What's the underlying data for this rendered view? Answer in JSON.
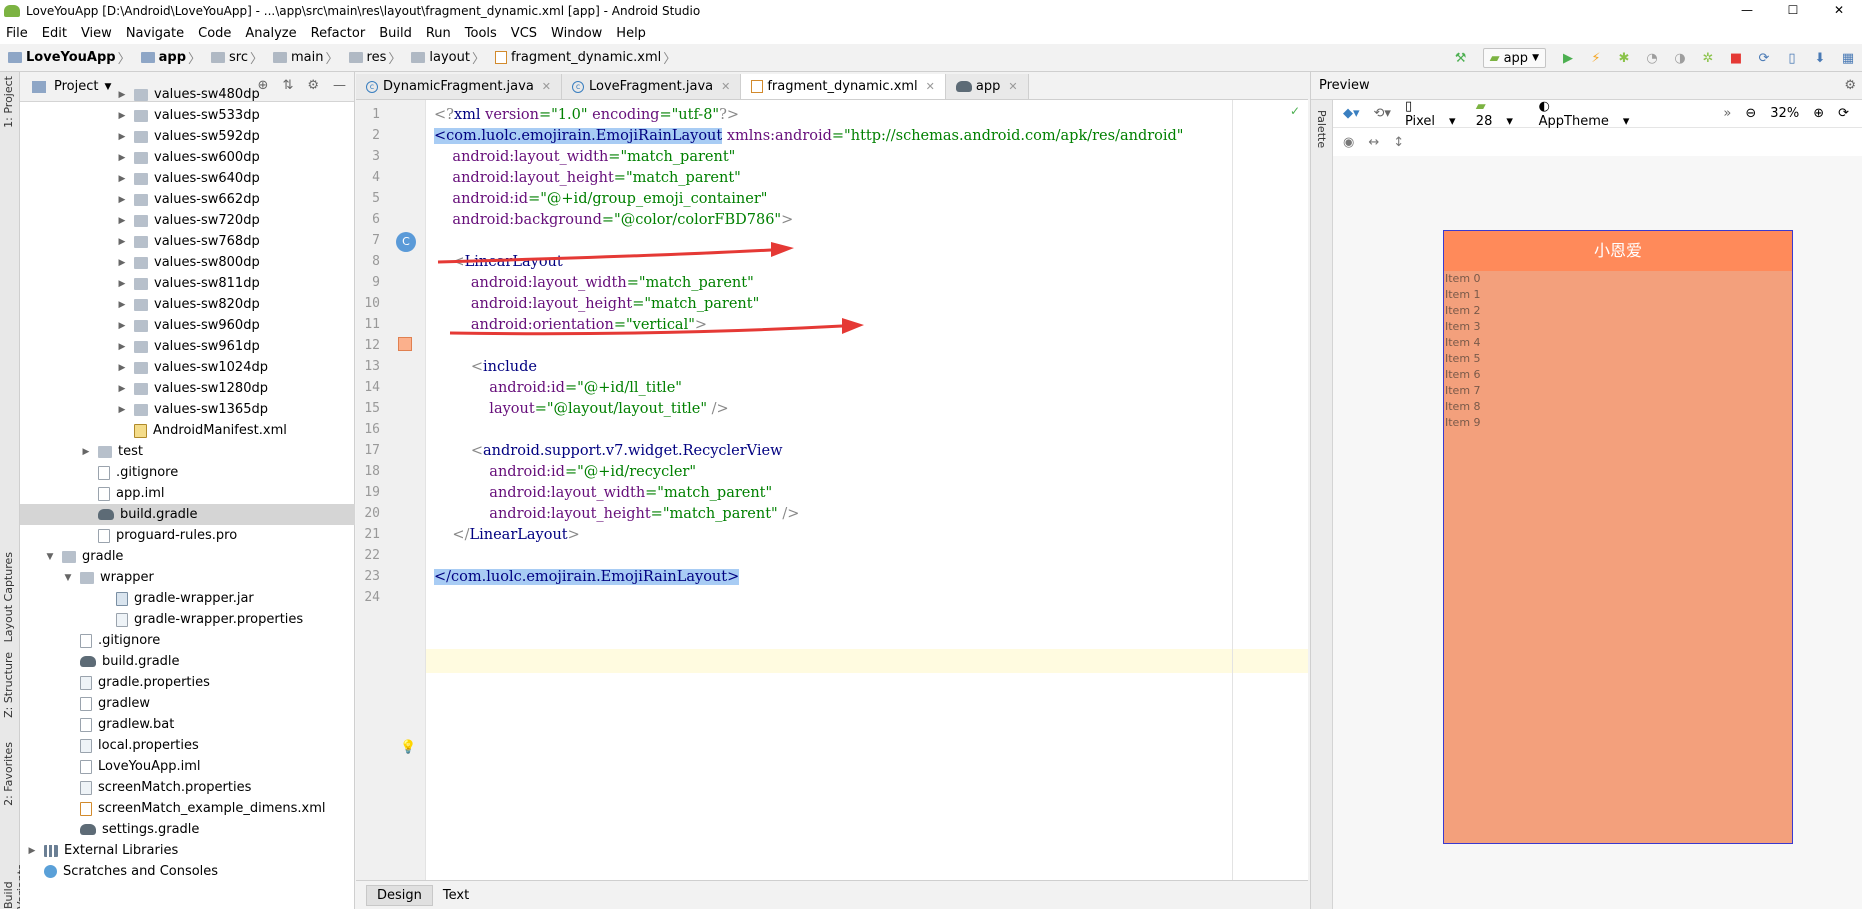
{
  "window": {
    "title": "LoveYouApp [D:\\Android\\LoveYouApp] - ...\\app\\src\\main\\res\\layout\\fragment_dynamic.xml [app] - Android Studio",
    "controls": [
      "—",
      "☐",
      "✕"
    ]
  },
  "menu": [
    "File",
    "Edit",
    "View",
    "Navigate",
    "Code",
    "Analyze",
    "Refactor",
    "Build",
    "Run",
    "Tools",
    "VCS",
    "Window",
    "Help"
  ],
  "breadcrumb": [
    "LoveYouApp",
    "app",
    "src",
    "main",
    "res",
    "layout",
    "fragment_dynamic.xml"
  ],
  "toolbar": {
    "config": "app"
  },
  "side_tabs": [
    "1: Project",
    "Layout Captures",
    "Z: Structure",
    "2: Favorites",
    "Build Variants"
  ],
  "project_panel": {
    "title": "Project",
    "items": [
      {
        "label": "values-sw480dp",
        "type": "folder",
        "indent": 5,
        "arrow": "▶"
      },
      {
        "label": "values-sw533dp",
        "type": "folder",
        "indent": 5,
        "arrow": "▶"
      },
      {
        "label": "values-sw592dp",
        "type": "folder",
        "indent": 5,
        "arrow": "▶"
      },
      {
        "label": "values-sw600dp",
        "type": "folder",
        "indent": 5,
        "arrow": "▶"
      },
      {
        "label": "values-sw640dp",
        "type": "folder",
        "indent": 5,
        "arrow": "▶"
      },
      {
        "label": "values-sw662dp",
        "type": "folder",
        "indent": 5,
        "arrow": "▶"
      },
      {
        "label": "values-sw720dp",
        "type": "folder",
        "indent": 5,
        "arrow": "▶"
      },
      {
        "label": "values-sw768dp",
        "type": "folder",
        "indent": 5,
        "arrow": "▶"
      },
      {
        "label": "values-sw800dp",
        "type": "folder",
        "indent": 5,
        "arrow": "▶"
      },
      {
        "label": "values-sw811dp",
        "type": "folder",
        "indent": 5,
        "arrow": "▶"
      },
      {
        "label": "values-sw820dp",
        "type": "folder",
        "indent": 5,
        "arrow": "▶"
      },
      {
        "label": "values-sw960dp",
        "type": "folder",
        "indent": 5,
        "arrow": "▶"
      },
      {
        "label": "values-sw961dp",
        "type": "folder",
        "indent": 5,
        "arrow": "▶"
      },
      {
        "label": "values-sw1024dp",
        "type": "folder",
        "indent": 5,
        "arrow": "▶"
      },
      {
        "label": "values-sw1280dp",
        "type": "folder",
        "indent": 5,
        "arrow": "▶"
      },
      {
        "label": "values-sw1365dp",
        "type": "folder",
        "indent": 5,
        "arrow": "▶"
      },
      {
        "label": "AndroidManifest.xml",
        "type": "manifest",
        "indent": 5,
        "arrow": ""
      },
      {
        "label": "test",
        "type": "folder",
        "indent": 3,
        "arrow": "▶"
      },
      {
        "label": ".gitignore",
        "type": "file",
        "indent": 3,
        "arrow": ""
      },
      {
        "label": "app.iml",
        "type": "file",
        "indent": 3,
        "arrow": ""
      },
      {
        "label": "build.gradle",
        "type": "gradle",
        "indent": 3,
        "arrow": "",
        "selected": true
      },
      {
        "label": "proguard-rules.pro",
        "type": "file",
        "indent": 3,
        "arrow": ""
      },
      {
        "label": "gradle",
        "type": "folder",
        "indent": 1,
        "arrow": "▼"
      },
      {
        "label": "wrapper",
        "type": "folder",
        "indent": 2,
        "arrow": "▼"
      },
      {
        "label": "gradle-wrapper.jar",
        "type": "jar",
        "indent": 4,
        "arrow": ""
      },
      {
        "label": "gradle-wrapper.properties",
        "type": "props",
        "indent": 4,
        "arrow": ""
      },
      {
        "label": ".gitignore",
        "type": "file",
        "indent": 2,
        "arrow": ""
      },
      {
        "label": "build.gradle",
        "type": "gradle",
        "indent": 2,
        "arrow": ""
      },
      {
        "label": "gradle.properties",
        "type": "props",
        "indent": 2,
        "arrow": ""
      },
      {
        "label": "gradlew",
        "type": "file",
        "indent": 2,
        "arrow": ""
      },
      {
        "label": "gradlew.bat",
        "type": "file",
        "indent": 2,
        "arrow": ""
      },
      {
        "label": "local.properties",
        "type": "props",
        "indent": 2,
        "arrow": ""
      },
      {
        "label": "LoveYouApp.iml",
        "type": "file",
        "indent": 2,
        "arrow": ""
      },
      {
        "label": "screenMatch.properties",
        "type": "props",
        "indent": 2,
        "arrow": ""
      },
      {
        "label": "screenMatch_example_dimens.xml",
        "type": "xml",
        "indent": 2,
        "arrow": ""
      },
      {
        "label": "settings.gradle",
        "type": "gradle",
        "indent": 2,
        "arrow": ""
      },
      {
        "label": "External Libraries",
        "type": "lib",
        "indent": 0,
        "arrow": "▶"
      },
      {
        "label": "Scratches and Consoles",
        "type": "scratch",
        "indent": 0,
        "arrow": ""
      }
    ]
  },
  "editor_tabs": [
    {
      "label": "DynamicFragment.java",
      "icon": "c"
    },
    {
      "label": "LoveFragment.java",
      "icon": "c"
    },
    {
      "label": "fragment_dynamic.xml",
      "icon": "xml",
      "active": true
    },
    {
      "label": "app",
      "icon": "gradle"
    }
  ],
  "code_lines": [
    {
      "n": "1",
      "html": [
        [
          "gray",
          "<?"
        ],
        [
          "kw",
          "xml "
        ],
        [
          "attr",
          "version"
        ],
        [
          "str",
          "=\"1.0\" "
        ],
        [
          "attr",
          "encoding"
        ],
        [
          "str",
          "=\"utf-8\""
        ],
        [
          "gray",
          "?>"
        ]
      ]
    },
    {
      "n": "2",
      "html": [
        [
          "hl kw",
          "<com.luolc.emojirain.EmojiRainLayout"
        ],
        [
          "kw",
          " "
        ],
        [
          "attr",
          "xmlns:android"
        ],
        [
          "str",
          "=\"http://schemas.android.com/apk/res/android\""
        ]
      ]
    },
    {
      "n": "3",
      "html": [
        [
          "attr",
          "    android:layout_width"
        ],
        [
          "str",
          "=\"match_parent\""
        ]
      ]
    },
    {
      "n": "4",
      "html": [
        [
          "attr",
          "    android:layout_height"
        ],
        [
          "str",
          "=\"match_parent\""
        ]
      ]
    },
    {
      "n": "5",
      "html": [
        [
          "attr",
          "    android:id"
        ],
        [
          "str",
          "=\"@+id/group_emoji_container\""
        ]
      ]
    },
    {
      "n": "6",
      "html": [
        [
          "attr",
          "    android:background"
        ],
        [
          "str",
          "=\"@color/colorFBD786\""
        ],
        [
          "gray",
          ">"
        ]
      ]
    },
    {
      "n": "7",
      "html": []
    },
    {
      "n": "8",
      "html": [
        [
          "gray",
          "    <"
        ],
        [
          "kw",
          "LinearLayout"
        ]
      ]
    },
    {
      "n": "9",
      "html": [
        [
          "attr",
          "        android:layout_width"
        ],
        [
          "str",
          "=\"match_parent\""
        ]
      ]
    },
    {
      "n": "10",
      "html": [
        [
          "attr",
          "        android:layout_height"
        ],
        [
          "str",
          "=\"match_parent\""
        ]
      ]
    },
    {
      "n": "11",
      "html": [
        [
          "attr",
          "        android:orientation"
        ],
        [
          "str",
          "=\"vertical\""
        ],
        [
          "gray",
          ">"
        ]
      ]
    },
    {
      "n": "12",
      "html": []
    },
    {
      "n": "13",
      "html": [
        [
          "gray",
          "        <"
        ],
        [
          "kw",
          "include"
        ]
      ]
    },
    {
      "n": "14",
      "html": [
        [
          "attr",
          "            android:id"
        ],
        [
          "str",
          "=\"@+id/ll_title\""
        ]
      ]
    },
    {
      "n": "15",
      "html": [
        [
          "attr",
          "            layout"
        ],
        [
          "str",
          "=\"@layout/layout_title\" "
        ],
        [
          "gray",
          "/>"
        ]
      ]
    },
    {
      "n": "16",
      "html": []
    },
    {
      "n": "17",
      "html": [
        [
          "gray",
          "        <"
        ],
        [
          "kw",
          "android.support.v7.widget.RecyclerView"
        ]
      ]
    },
    {
      "n": "18",
      "html": [
        [
          "attr",
          "            android:id"
        ],
        [
          "str",
          "=\"@+id/recycler\""
        ]
      ]
    },
    {
      "n": "19",
      "html": [
        [
          "attr",
          "            android:layout_width"
        ],
        [
          "str",
          "=\"match_parent\""
        ]
      ]
    },
    {
      "n": "20",
      "html": [
        [
          "attr",
          "            android:layout_height"
        ],
        [
          "str",
          "=\"match_parent\" "
        ],
        [
          "gray",
          "/>"
        ]
      ]
    },
    {
      "n": "21",
      "html": [
        [
          "gray",
          "    </"
        ],
        [
          "kw",
          "LinearLayout"
        ],
        [
          "gray",
          ">"
        ]
      ]
    },
    {
      "n": "22",
      "html": []
    },
    {
      "n": "23",
      "html": [
        [
          "hl kw",
          "</com.luolc.emojirain.EmojiRainLayout>"
        ]
      ]
    },
    {
      "n": "24",
      "html": []
    }
  ],
  "bottom_tabs": {
    "design": "Design",
    "text": "Text"
  },
  "preview": {
    "title": "Preview",
    "palette": "Palette",
    "device": "Pixel",
    "api": "28",
    "theme": "AppTheme",
    "zoom": "32%",
    "app_title": "小恩爱",
    "items": [
      "Item 0",
      "Item 1",
      "Item 2",
      "Item 3",
      "Item 4",
      "Item 5",
      "Item 6",
      "Item 7",
      "Item 8",
      "Item 9"
    ]
  },
  "colors": {
    "accent_orange": "#ff8a5a",
    "preview_bg": "#f3a07c",
    "selection": "#a8ccf4",
    "arrow_red": "#e53935"
  }
}
